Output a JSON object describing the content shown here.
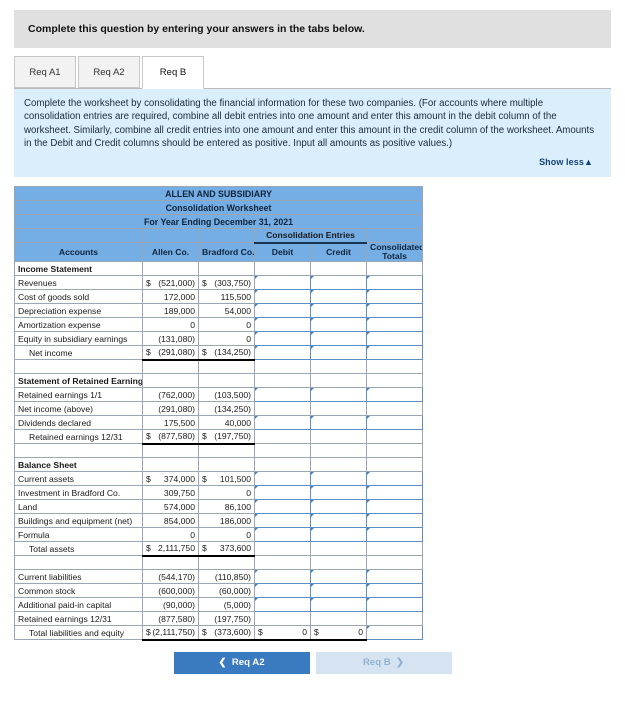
{
  "instruction": "Complete this question by entering your answers in the tabs below.",
  "tabs": [
    {
      "label": "Req A1",
      "active": false
    },
    {
      "label": "Req A2",
      "active": false
    },
    {
      "label": "Req B",
      "active": true
    }
  ],
  "description": "Complete the worksheet by consolidating the financial information for these two companies. (For accounts where multiple consolidation entries are required, combine all debit entries into one amount and enter this amount in the debit column of the worksheet. Similarly, combine all credit entries into one amount and enter this amount in the credit column of the worksheet. Amounts in the Debit and Credit columns should be entered as positive. Input all amounts as positive values.)",
  "show_less_label": "Show less",
  "show_less_icon": "▲",
  "worksheet": {
    "title_line1": "ALLEN AND SUBSIDIARY",
    "title_line2": "Consolidation Worksheet",
    "title_line3": "For Year Ending December 31, 2021",
    "group_header": "Consolidation Entries",
    "columns": {
      "accounts": "Accounts",
      "allen": "Allen Co.",
      "bradford": "Bradford Co.",
      "debit": "Debit",
      "credit": "Credit",
      "consolidated": "Consolidated Totals"
    },
    "rows": [
      {
        "type": "section",
        "account": "Income Statement"
      },
      {
        "type": "data",
        "account": "Revenues",
        "allen_sym": "$",
        "allen": "(521,000)",
        "brad_sym": "$",
        "bradford": "(303,750)"
      },
      {
        "type": "data",
        "account": "Cost of goods sold",
        "allen_sym": "",
        "allen": "172,000",
        "brad_sym": "",
        "bradford": "115,500"
      },
      {
        "type": "data",
        "account": "Depreciation expense",
        "allen_sym": "",
        "allen": "189,000",
        "brad_sym": "",
        "bradford": "54,000"
      },
      {
        "type": "data",
        "account": "Amortization expense",
        "allen_sym": "",
        "allen": "0",
        "brad_sym": "",
        "bradford": "0"
      },
      {
        "type": "data",
        "account": "Equity in subsidiary earnings",
        "allen_sym": "",
        "allen": "(131,080)",
        "brad_sym": "",
        "bradford": "0"
      },
      {
        "type": "subtotal",
        "rule": "thick",
        "account": "Net income",
        "indent": true,
        "allen_sym": "$",
        "allen": "(291,080)",
        "brad_sym": "$",
        "bradford": "(134,250)"
      },
      {
        "type": "spacer"
      },
      {
        "type": "section",
        "account": "Statement of Retained Earnings"
      },
      {
        "type": "data",
        "account": "Retained earnings 1/1",
        "allen_sym": "",
        "allen": "(762,000)",
        "brad_sym": "",
        "bradford": "(103,500)"
      },
      {
        "type": "data",
        "account": "Net income (above)",
        "allen_sym": "",
        "allen": "(291,080)",
        "brad_sym": "",
        "bradford": "(134,250)",
        "no_inputs": true
      },
      {
        "type": "data",
        "account": "Dividends declared",
        "allen_sym": "",
        "allen": "175,500",
        "brad_sym": "",
        "bradford": "40,000"
      },
      {
        "type": "subtotal",
        "rule": "thick",
        "account": "Retained earnings 12/31",
        "indent": true,
        "allen_sym": "$",
        "allen": "(877,580)",
        "brad_sym": "$",
        "bradford": "(197,750)",
        "no_inputs": true
      },
      {
        "type": "spacer"
      },
      {
        "type": "section",
        "account": "Balance Sheet"
      },
      {
        "type": "data",
        "account": "Current assets",
        "allen_sym": "$",
        "allen": "374,000",
        "brad_sym": "$",
        "bradford": "101,500"
      },
      {
        "type": "data",
        "account": "Investment in Bradford Co.",
        "allen_sym": "",
        "allen": "309,750",
        "brad_sym": "",
        "bradford": "0"
      },
      {
        "type": "data",
        "account": "Land",
        "allen_sym": "",
        "allen": "574,000",
        "brad_sym": "",
        "bradford": "86,100"
      },
      {
        "type": "data",
        "account": "Buildings and equipment (net)",
        "allen_sym": "",
        "allen": "854,000",
        "brad_sym": "",
        "bradford": "186,000"
      },
      {
        "type": "data",
        "account": "Formula",
        "allen_sym": "",
        "allen": "0",
        "brad_sym": "",
        "bradford": "0"
      },
      {
        "type": "subtotal",
        "rule": "thick",
        "account": "Total assets",
        "indent": true,
        "allen_sym": "$",
        "allen": "2,111,750",
        "brad_sym": "$",
        "bradford": "373,600",
        "no_inputs": true
      },
      {
        "type": "spacer"
      },
      {
        "type": "data",
        "account": "Current liabilities",
        "allen_sym": "",
        "allen": "(544,170)",
        "brad_sym": "",
        "bradford": "(110,850)"
      },
      {
        "type": "data",
        "account": "Common stock",
        "allen_sym": "",
        "allen": "(600,000)",
        "brad_sym": "",
        "bradford": "(60,000)"
      },
      {
        "type": "data",
        "account": "Additional paid-in capital",
        "allen_sym": "",
        "allen": "(90,000)",
        "brad_sym": "",
        "bradford": "(5,000)"
      },
      {
        "type": "data",
        "account": "Retained earnings 12/31",
        "allen_sym": "",
        "allen": "(877,580)",
        "brad_sym": "",
        "bradford": "(197,750)",
        "no_inputs": true
      },
      {
        "type": "total",
        "rule": "thick",
        "account": "Total liabilities and equity",
        "indent": true,
        "allen_sym": "$",
        "allen": "(2,111,750)",
        "brad_sym": "$",
        "bradford": "(373,600)",
        "debit_sym": "$",
        "debit": "0",
        "credit_sym": "$",
        "credit": "0"
      }
    ]
  },
  "nav": {
    "prev_label": "Req A2",
    "prev_icon": "❮",
    "next_label": "Req B",
    "next_icon": "❯"
  }
}
